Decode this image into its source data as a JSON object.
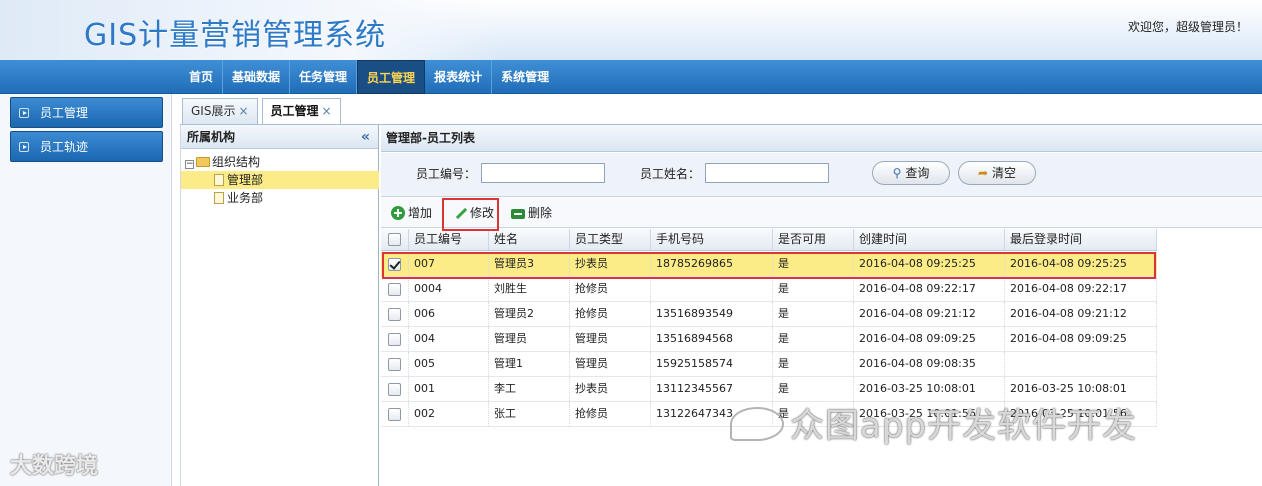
{
  "header": {
    "title": "GIS计量营销管理系统",
    "welcome": "欢迎您，超级管理员！"
  },
  "nav": {
    "items": [
      {
        "label": "首页",
        "active": false
      },
      {
        "label": "基础数据",
        "active": false
      },
      {
        "label": "任务管理",
        "active": false
      },
      {
        "label": "员工管理",
        "active": true
      },
      {
        "label": "报表统计",
        "active": false
      },
      {
        "label": "系统管理",
        "active": false
      }
    ]
  },
  "left_menu": {
    "items": [
      {
        "label": "员工管理"
      },
      {
        "label": "员工轨迹"
      }
    ]
  },
  "tabs": [
    {
      "label": "GIS展示",
      "close": "×",
      "active": false
    },
    {
      "label": "员工管理",
      "close": "×",
      "active": true
    }
  ],
  "org": {
    "title": "所属机构",
    "collapse_glyph": "«",
    "root": {
      "label": "组织结构",
      "expander": "−"
    },
    "children": [
      {
        "label": "管理部",
        "selected": true
      },
      {
        "label": "业务部",
        "selected": false
      }
    ]
  },
  "main": {
    "title": "管理部-员工列表",
    "search": {
      "emp_no_label": "员工编号：",
      "emp_no_value": "",
      "emp_name_label": "员工姓名：",
      "emp_name_value": "",
      "query_label": "查询",
      "clear_label": "清空"
    },
    "toolbar": {
      "add_label": "增加",
      "edit_label": "修改",
      "delete_label": "删除"
    },
    "grid": {
      "columns": [
        "员工编号",
        "姓名",
        "员工类型",
        "手机号码",
        "是否可用",
        "创建时间",
        "最后登录时间"
      ],
      "rows": [
        {
          "checked": true,
          "selected": true,
          "cells": [
            "007",
            "管理员3",
            "抄表员",
            "18785269865",
            "是",
            "2016-04-08 09:25:25",
            "2016-04-08 09:25:25"
          ]
        },
        {
          "checked": false,
          "selected": false,
          "cells": [
            "0004",
            "刘胜生",
            "抢修员",
            "",
            "是",
            "2016-04-08 09:22:17",
            "2016-04-08 09:22:17"
          ]
        },
        {
          "checked": false,
          "selected": false,
          "cells": [
            "006",
            "管理员2",
            "抢修员",
            "13516893549",
            "是",
            "2016-04-08 09:21:12",
            "2016-04-08 09:21:12"
          ]
        },
        {
          "checked": false,
          "selected": false,
          "cells": [
            "004",
            "管理员",
            "管理员",
            "13516894568",
            "是",
            "2016-04-08 09:09:25",
            "2016-04-08 09:09:25"
          ]
        },
        {
          "checked": false,
          "selected": false,
          "cells": [
            "005",
            "管理1",
            "管理员",
            "15925158574",
            "是",
            "2016-04-08 09:08:35",
            ""
          ]
        },
        {
          "checked": false,
          "selected": false,
          "cells": [
            "001",
            "李工",
            "抄表员",
            "13112345567",
            "是",
            "2016-03-25 10:08:01",
            "2016-03-25 10:08:01"
          ]
        },
        {
          "checked": false,
          "selected": false,
          "cells": [
            "002",
            "张工",
            "抢修员",
            "13122647343",
            "是",
            "2016-03-25 10:01:56",
            "2016-03-25 10:01:56"
          ]
        }
      ]
    }
  },
  "watermarks": {
    "left": "大数跨境",
    "right": "众图app开发软件开发"
  },
  "colors": {
    "nav_bg": "#2a7cc9",
    "nav_active_text": "#ffd34d",
    "title_blue": "#2e7ac6",
    "selection_yellow": "#fbec88",
    "highlight_red": "#dd3333"
  }
}
